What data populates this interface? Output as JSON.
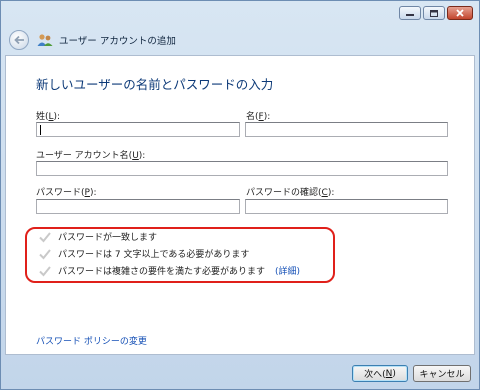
{
  "window": {
    "title": "ユーザー アカウントの追加"
  },
  "form": {
    "heading": "新しいユーザーの名前とパスワードの入力",
    "last_name": {
      "label": "姓(",
      "key": "L",
      "suffix": "):",
      "value": ""
    },
    "first_name": {
      "label": "名(",
      "key": "F",
      "suffix": "):",
      "value": ""
    },
    "account_name": {
      "label": "ユーザー アカウント名(",
      "key": "U",
      "suffix": "):",
      "value": ""
    },
    "password": {
      "label": "パスワード(",
      "key": "P",
      "suffix": "):",
      "value": ""
    },
    "password_confirm": {
      "label": "パスワードの確認(",
      "key": "C",
      "suffix": "):",
      "value": ""
    }
  },
  "requirements": [
    {
      "text": "パスワードが一致します"
    },
    {
      "text": "パスワードは 7 文字以上である必要があります"
    },
    {
      "text": "パスワードは複雑さの要件を満たす必要があります",
      "link": "(詳細)"
    }
  ],
  "policy_link": "パスワード ポリシーの変更",
  "buttons": {
    "next": {
      "label": "次へ(",
      "key": "N",
      "suffix": ")"
    },
    "cancel": "キャンセル"
  },
  "colors": {
    "title": "#0d3a78",
    "link": "#1550b6",
    "highlight": "#e0201a"
  }
}
